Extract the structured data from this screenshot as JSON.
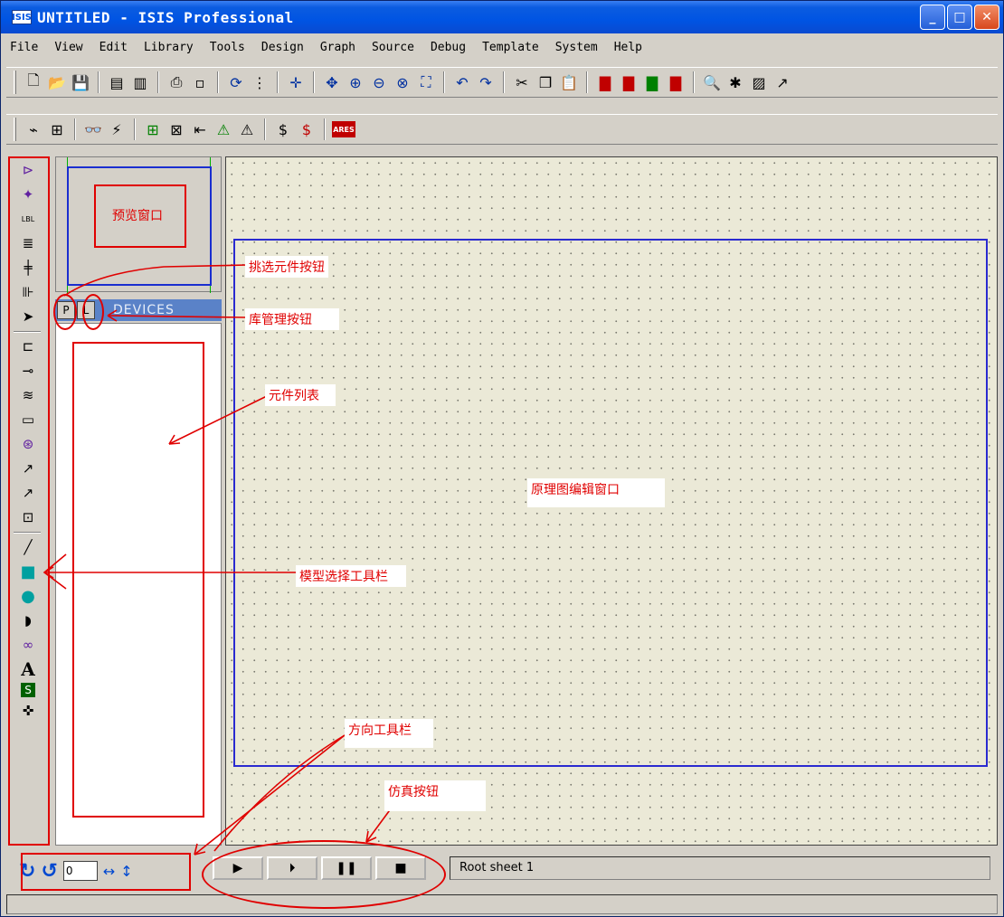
{
  "window": {
    "app_icon": "ISIS",
    "title": "UNTITLED - ISIS Professional",
    "minimize_glyph": "_",
    "maximize_glyph": "□",
    "close_glyph": "✕"
  },
  "menu": [
    "File",
    "View",
    "Edit",
    "Library",
    "Tools",
    "Design",
    "Graph",
    "Source",
    "Debug",
    "Template",
    "System",
    "Help"
  ],
  "toolbar1": [
    {
      "name": "new-file-icon",
      "glyph": "🗋"
    },
    {
      "name": "open-file-icon",
      "glyph": "📂"
    },
    {
      "name": "save-file-icon",
      "glyph": "💾"
    },
    {
      "sep": true
    },
    {
      "name": "import-section-icon",
      "glyph": "▤"
    },
    {
      "name": "export-section-icon",
      "glyph": "▥"
    },
    {
      "sep": true
    },
    {
      "name": "print-icon",
      "glyph": "⎙"
    },
    {
      "name": "set-area-icon",
      "glyph": "▫"
    },
    {
      "sep": true
    },
    {
      "name": "redraw-icon",
      "glyph": "⟳"
    },
    {
      "name": "grid-icon",
      "glyph": "⋮"
    },
    {
      "sep": true
    },
    {
      "name": "origin-icon",
      "glyph": "✛"
    },
    {
      "sep": true
    },
    {
      "name": "pan-icon",
      "glyph": "✥"
    },
    {
      "name": "zoom-in-icon",
      "glyph": "⊕"
    },
    {
      "name": "zoom-out-icon",
      "glyph": "⊖"
    },
    {
      "name": "zoom-all-icon",
      "glyph": "⊗"
    },
    {
      "name": "zoom-area-icon",
      "glyph": "⛶"
    },
    {
      "sep": true
    },
    {
      "name": "undo-icon",
      "glyph": "↶"
    },
    {
      "name": "redo-icon",
      "glyph": "↷"
    },
    {
      "sep": true
    },
    {
      "name": "cut-icon",
      "glyph": "✂"
    },
    {
      "name": "copy-icon",
      "glyph": "❐"
    },
    {
      "name": "paste-icon",
      "glyph": "📋"
    },
    {
      "sep": true
    },
    {
      "name": "block-copy-icon",
      "glyph": "▇"
    },
    {
      "name": "block-move-icon",
      "glyph": "▇"
    },
    {
      "name": "block-rotate-icon",
      "glyph": "▇"
    },
    {
      "name": "block-delete-icon",
      "glyph": "▇"
    },
    {
      "sep": true
    },
    {
      "name": "pick-device-icon",
      "glyph": "🔍"
    },
    {
      "name": "make-device-icon",
      "glyph": "✱"
    },
    {
      "name": "package-tool-icon",
      "glyph": "▨"
    },
    {
      "name": "decompose-icon",
      "glyph": "↗"
    }
  ],
  "toolbar2": [
    {
      "name": "wire-autorouter-icon",
      "glyph": "⌁"
    },
    {
      "name": "property-assignment-icon",
      "glyph": "⊞"
    },
    {
      "sep": true
    },
    {
      "name": "search-tag-icon",
      "glyph": "👓"
    },
    {
      "name": "property-tool-icon",
      "glyph": "⚡"
    },
    {
      "sep": true
    },
    {
      "name": "new-sheet-icon",
      "glyph": "⊞"
    },
    {
      "name": "remove-sheet-icon",
      "glyph": "⊠"
    },
    {
      "name": "exit-to-parent-icon",
      "glyph": "⇤"
    },
    {
      "name": "view-bom-icon",
      "glyph": "⚠"
    },
    {
      "name": "electrical-check-icon",
      "glyph": "⚠"
    },
    {
      "sep": true
    },
    {
      "name": "netlist-icon",
      "glyph": "$"
    },
    {
      "name": "netlist-ares-icon",
      "glyph": "$"
    },
    {
      "sep": true
    },
    {
      "name": "ares-icon",
      "glyph": "ARES"
    }
  ],
  "mode_toolbar": [
    {
      "name": "component-mode-icon",
      "glyph": "⊳"
    },
    {
      "name": "junction-dot-icon",
      "glyph": "✦"
    },
    {
      "name": "wire-label-icon",
      "glyph": "LBL"
    },
    {
      "name": "text-script-icon",
      "glyph": "≣"
    },
    {
      "name": "bus-icon",
      "glyph": "╪"
    },
    {
      "name": "subcircuit-icon",
      "glyph": "⊪"
    },
    {
      "name": "selection-icon",
      "glyph": "➤"
    },
    {
      "sep": true
    },
    {
      "name": "terminals-icon",
      "glyph": "⊏"
    },
    {
      "name": "device-pins-icon",
      "glyph": "⊸"
    },
    {
      "name": "graph-icon",
      "glyph": "≋"
    },
    {
      "name": "tape-recorder-icon",
      "glyph": "▭"
    },
    {
      "name": "generator-icon",
      "glyph": "⊛"
    },
    {
      "name": "voltage-probe-icon",
      "glyph": "↗"
    },
    {
      "name": "current-probe-icon",
      "glyph": "↗"
    },
    {
      "name": "virtual-instruments-icon",
      "glyph": "⊡"
    },
    {
      "sep": true
    },
    {
      "name": "line-icon",
      "glyph": "╱"
    },
    {
      "name": "box-icon",
      "glyph": "■"
    },
    {
      "name": "circle-icon",
      "glyph": "●"
    },
    {
      "name": "arc-icon",
      "glyph": "◗"
    },
    {
      "name": "path-icon",
      "glyph": "∞"
    },
    {
      "name": "text-icon",
      "glyph": "A"
    },
    {
      "name": "symbol-icon",
      "glyph": "S"
    },
    {
      "name": "marker-icon",
      "glyph": "✜"
    }
  ],
  "panel": {
    "pick_button": "P",
    "library_button": "L",
    "devices_label": "DEVICES"
  },
  "bottom": {
    "rotate_cw_glyph": "↻",
    "rotate_ccw_glyph": "↺",
    "rotation_value": "0",
    "mirror_x_glyph": "↔",
    "mirror_y_glyph": "↕",
    "sim_buttons": [
      {
        "name": "play-icon",
        "glyph": "▶"
      },
      {
        "name": "step-icon",
        "glyph": "⏵"
      },
      {
        "name": "pause-icon",
        "glyph": "❚❚"
      },
      {
        "name": "stop-icon",
        "glyph": "■"
      }
    ],
    "sheet_status": "Root sheet 1"
  },
  "annotations": {
    "preview_window": "预览窗口",
    "pick_device_button": "挑选元件按钮",
    "library_manager_button": "库管理按钮",
    "device_list": "元件列表",
    "schematic_editor": "原理图编辑窗口",
    "mode_toolbar": "模型选择工具栏",
    "orientation_toolbar": "方向工具栏",
    "simulation_buttons": "仿真按钮"
  },
  "colors": {
    "annotation": "#e00000",
    "titlebar": "#0054e3",
    "sheet_border": "#2a2ad0",
    "devices_header": "#5a82c8"
  }
}
